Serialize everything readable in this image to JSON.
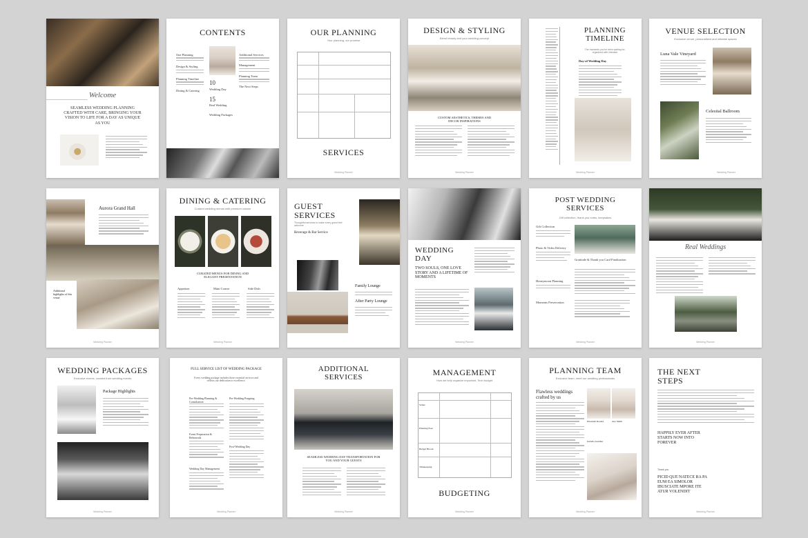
{
  "pages": {
    "welcome": {
      "script_title": "Welcome",
      "tagline": "SEAMLESS WEDDING PLANNING CRAFTED WITH CARE, BRINGING YOUR VISION TO LIFE FOR A DAY AS UNIQUE AS YOU"
    },
    "contents": {
      "title": "CONTENTS",
      "items": [
        "One Planning",
        "Design & Styling",
        "Planning Timeline",
        "Dining & Catering",
        "Additional Services",
        "Management",
        "Planning Team",
        "The Next Steps",
        "Wedding Day",
        "Real Wedding",
        "Wedding Packages"
      ],
      "numbers": [
        "10",
        "15"
      ]
    },
    "our_planning": {
      "title": "OUR PLANNING",
      "subtitle": "Your planning, our promise",
      "bottom_title": "SERVICES"
    },
    "design": {
      "title": "DESIGN & STYLING",
      "subtitle": "Blend beauty and your wedding concept",
      "caption": "CUSTOM AESTHETICS, THEMES AND DECOR INSPIRATIONS"
    },
    "timeline": {
      "title": "PLANNING TIMELINE",
      "subtitle": "The moments you've been waiting for, organized with intention",
      "section": "Day-of Wedding Day"
    },
    "venue": {
      "title": "VENUE SELECTION",
      "subtitle": "Exclusive venue, personalized and intimate spaces",
      "venue1": "Luna Vale Vineyard",
      "venue2": "Celestial Ballroom"
    },
    "aurora": {
      "title": "Aurora Grand Hall",
      "caption": "Additional highlights of this venue"
    },
    "dining": {
      "title": "DINING & CATERING",
      "subtitle": "Curated wedding menus with premium cuisine",
      "caption": "CURATED MENUS FOR DINING AND ELEGANT PRESENTATION",
      "cols": [
        "Appetizer",
        "Main Course",
        "Side Dish"
      ]
    },
    "guest": {
      "title": "GUEST SERVICES",
      "subtitle": "Thoughtful services to make every guest feel welcome",
      "h1": "Beverage & Bar Service",
      "h2": "Family Lounge",
      "h3": "After Party Lounge"
    },
    "wedding_day": {
      "title": "WEDDING DAY",
      "sub": "TWO SOULS, ONE LOVE STORY AND A LIFETIME OF MOMENTS"
    },
    "post": {
      "title": "POST WEDDING SERVICES",
      "subtitle": "Gift collection, thank you notes, keepsakes",
      "h1": "Gift Collection",
      "h2": "Photo & Video Delivery",
      "h3": "Honeymoon Planning",
      "h4": "Moments Preservation",
      "h5": "Gratitude & Thank you Card Finalization"
    },
    "real": {
      "script_title": "Real Weddings"
    },
    "packages": {
      "title": "WEDDING PACKAGES",
      "subtitle": "Exclusive events, curated from wedding events",
      "highlights": "Package Highlights"
    },
    "full_service": {
      "title": "FULL SERVICE LIST OF WEDDING PACKAGE",
      "intro": "Every wedding package includes these essential services and reflects our dedication to excellence.",
      "h1": "Pre-Wedding Planning & Consultation",
      "h2": "Event Preparation & Rehearsals",
      "h3": "Wedding Day Management",
      "h4": "Post-Wedding Day",
      "h5": "Pre-Wedding Prepping"
    },
    "additional": {
      "title": "ADDITIONAL SERVICES",
      "caption": "SEAMLESS WEDDING DAY TRANSPORTATION FOR YOU AND YOUR GUESTS"
    },
    "management": {
      "title": "MANAGEMENT",
      "subtitle": "How we help organize important, Tech budget",
      "bottom_title": "BUDGETING",
      "rows": [
        "Venue",
        "Planning Fees",
        "Budget Bloom",
        "Timekeeping"
      ]
    },
    "team": {
      "title": "PLANNING TEAM",
      "subtitle": "Exclusive team, meet our wedding professionals",
      "heading": "Flawless weddings crafted by us",
      "name1": "Elisabeth Ronald",
      "name2": "Ana Smith",
      "name3": "Isabella Gunther"
    },
    "next": {
      "title": "THE NEXT STEPS",
      "mid": "HAPPILY EVER AFTER STARTS NOW INTO FOREVER",
      "quote": "PICID QUE NATECE RA PA EUM EA SIMOLOR IBUSCIATE MPORE ITE ATUR VOLENDIT",
      "thanks": "Thank you"
    },
    "footer": "Wedding Planner"
  }
}
